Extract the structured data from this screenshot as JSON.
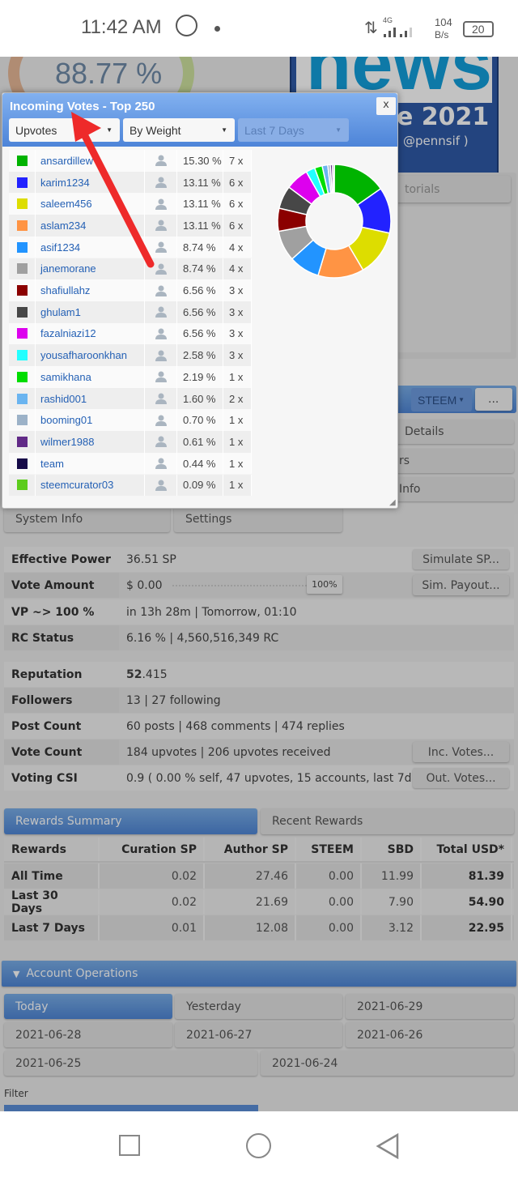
{
  "status_bar": {
    "time": "11:42 AM",
    "network": "4G",
    "speed_value": "104",
    "speed_unit": "B/s",
    "battery": "20"
  },
  "background": {
    "vp_gauge": "88.77 %",
    "banner_word": "news",
    "banner_date": "e 2021",
    "banner_user": "@pennsif )",
    "menu_partial": "torials",
    "currency_select": "STEEM",
    "more_button": "...",
    "side_buttons": [
      "Details",
      "rs",
      "Info"
    ],
    "tabs": [
      "System Info",
      "Settings"
    ],
    "stats": [
      {
        "label": "Effective Power",
        "value": "36.51 SP",
        "button": "Simulate SP..."
      },
      {
        "label": "Vote Amount",
        "value": "$ 0.00",
        "slider": "100%",
        "button": "Sim. Payout..."
      },
      {
        "label": "VP ~> 100 %",
        "value": "in 13h 28m  |  Tomorrow, 01:10"
      },
      {
        "label": "RC Status",
        "value": "6.16 %  |  4,560,516,349 RC"
      },
      {
        "label": "Reputation",
        "value_bold": "52",
        "value": ".415"
      },
      {
        "label": "Followers",
        "value": "13  |  27 following"
      },
      {
        "label": "Post Count",
        "value": "60 posts  |  468 comments  |  474 replies"
      },
      {
        "label": "Vote Count",
        "value": "184 upvotes  |  206 upvotes received",
        "button": "Inc. Votes..."
      },
      {
        "label": "Voting CSI",
        "value": "0.9 ( 0.00 % self, 47 upvotes, 15 accounts, last 7d )",
        "button": "Out. Votes..."
      }
    ],
    "rewards_tabs": [
      "Rewards Summary",
      "Recent Rewards"
    ],
    "rewards": {
      "headers": [
        "Rewards",
        "Curation SP",
        "Author SP",
        "STEEM",
        "SBD",
        "Total USD*"
      ],
      "rows": [
        [
          "All Time",
          "0.02",
          "27.46",
          "0.00",
          "11.99",
          "81.39"
        ],
        [
          "Last 30 Days",
          "0.02",
          "21.69",
          "0.00",
          "7.90",
          "54.90"
        ],
        [
          "Last 7 Days",
          "0.01",
          "12.08",
          "0.00",
          "3.12",
          "22.95"
        ]
      ]
    },
    "account_operations": "Account Operations",
    "date_buttons": [
      "Today",
      "Yesterday",
      "2021-06-29",
      "2021-06-28",
      "2021-06-27",
      "2021-06-26",
      "2021-06-25",
      "2021-06-24"
    ],
    "filter_label": "Filter"
  },
  "modal": {
    "title": "Incoming Votes - Top 250",
    "close": "x",
    "selects": [
      "Upvotes",
      "By Weight",
      "Last 7 Days"
    ],
    "voters": [
      {
        "name": "ansardillew",
        "pct": 15.3,
        "pct_label": "15.30 %",
        "count": "7 x",
        "color": "#00b300"
      },
      {
        "name": "karim1234",
        "pct": 13.11,
        "pct_label": "13.11 %",
        "count": "6 x",
        "color": "#2222ff"
      },
      {
        "name": "saleem456",
        "pct": 13.11,
        "pct_label": "13.11 %",
        "count": "6 x",
        "color": "#dddd00"
      },
      {
        "name": "aslam234",
        "pct": 13.11,
        "pct_label": "13.11 %",
        "count": "6 x",
        "color": "#ff9444"
      },
      {
        "name": "asif1234",
        "pct": 8.74,
        "pct_label": "8.74 %",
        "count": "4 x",
        "color": "#2294ff"
      },
      {
        "name": "janemorane",
        "pct": 8.74,
        "pct_label": "8.74 %",
        "count": "4 x",
        "color": "#a0a0a0"
      },
      {
        "name": "shafiullahz",
        "pct": 6.56,
        "pct_label": "6.56 %",
        "count": "3 x",
        "color": "#8b0000"
      },
      {
        "name": "ghulam1",
        "pct": 6.56,
        "pct_label": "6.56 %",
        "count": "3 x",
        "color": "#474747"
      },
      {
        "name": "fazalniazi12",
        "pct": 6.56,
        "pct_label": "6.56 %",
        "count": "3 x",
        "color": "#dd00ee"
      },
      {
        "name": "yousafharoonkhan",
        "pct": 2.58,
        "pct_label": "2.58 %",
        "count": "3 x",
        "color": "#22ffff"
      },
      {
        "name": "samikhana",
        "pct": 2.19,
        "pct_label": "2.19 %",
        "count": "1 x",
        "color": "#00dd00"
      },
      {
        "name": "rashid001",
        "pct": 1.6,
        "pct_label": "1.60 %",
        "count": "2 x",
        "color": "#6ab4f0"
      },
      {
        "name": "booming01",
        "pct": 0.7,
        "pct_label": "0.70 %",
        "count": "1 x",
        "color": "#9cb2c8"
      },
      {
        "name": "wilmer1988",
        "pct": 0.61,
        "pct_label": "0.61 %",
        "count": "1 x",
        "color": "#612a87"
      },
      {
        "name": "team",
        "pct": 0.44,
        "pct_label": "0.44 %",
        "count": "1 x",
        "color": "#160a48"
      },
      {
        "name": "steemcurator03",
        "pct": 0.09,
        "pct_label": "0.09 %",
        "count": "1 x",
        "color": "#5ccc1c"
      }
    ]
  },
  "colors": {
    "accent_blue": "#4f86d6",
    "link": "#2561b5",
    "annotation": "#ee2a2a"
  }
}
